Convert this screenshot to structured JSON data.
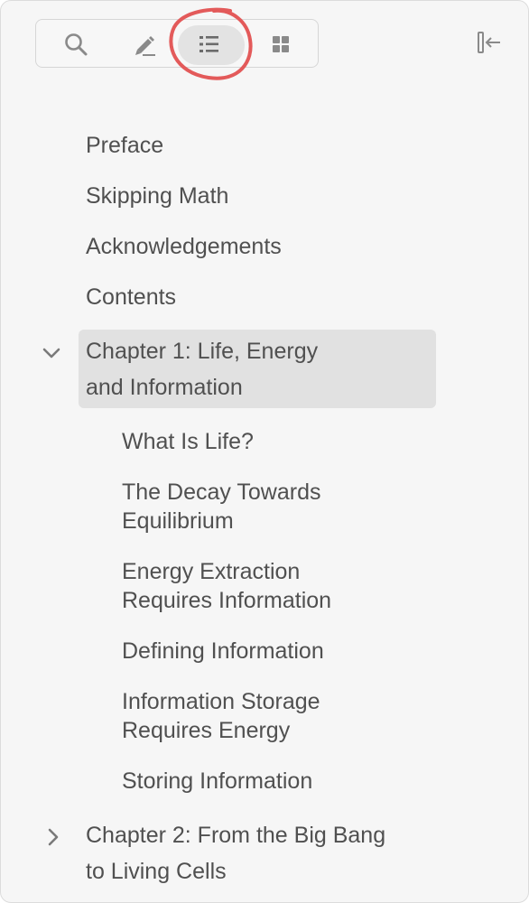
{
  "toolbar": {
    "buttons": [
      {
        "icon": "search-icon"
      },
      {
        "icon": "pencil-icon"
      },
      {
        "icon": "list-icon",
        "active": true
      },
      {
        "icon": "grid-icon"
      }
    ],
    "collapse_icon": "collapse-sidebar-icon",
    "highlight_color": "#e35a5a"
  },
  "toc": {
    "items": [
      {
        "label": "Preface",
        "level": 0
      },
      {
        "label": "Skipping Math",
        "level": 0
      },
      {
        "label": "Acknowledgements",
        "level": 0
      },
      {
        "label": "Contents",
        "level": 0
      },
      {
        "label": "Chapter 1: Life, Energy\nand Information",
        "level": 0,
        "expanded": true,
        "selected": true
      },
      {
        "label": "What Is Life?",
        "level": 1
      },
      {
        "label": "The Decay Towards\nEquilibrium",
        "level": 1
      },
      {
        "label": "Energy Extraction\nRequires Information",
        "level": 1
      },
      {
        "label": "Defining Information",
        "level": 1
      },
      {
        "label": "Information Storage\nRequires Energy",
        "level": 1
      },
      {
        "label": "Storing Information",
        "level": 1
      },
      {
        "label": "Chapter 2: From the Big Bang\nto Living Cells",
        "level": 0,
        "expanded": false
      }
    ]
  },
  "colors": {
    "panel_bg": "#f6f6f6",
    "text": "#505050",
    "selected_bg": "#e1e1e1",
    "icon": "#8a8a8a"
  }
}
